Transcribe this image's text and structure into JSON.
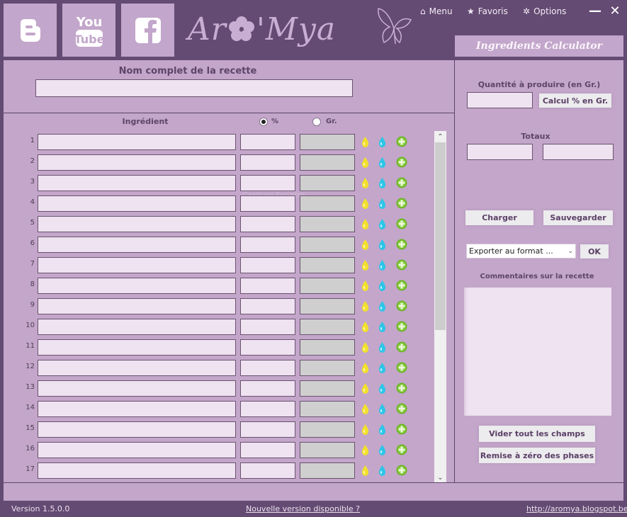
{
  "social": {
    "blogger_label": "Blogger",
    "youtube_label": "YouTube",
    "facebook_label": "Facebook"
  },
  "logo": {
    "part1": "Ar",
    "part2": "'Mya"
  },
  "menu": {
    "items": [
      {
        "icon": "home-icon",
        "glyph": "⌂",
        "label": "Menu"
      },
      {
        "icon": "star-icon",
        "glyph": "★",
        "label": "Favoris"
      },
      {
        "icon": "options-icon",
        "glyph": "✲",
        "label": "Options"
      }
    ],
    "minimize": "—",
    "close": "✕"
  },
  "right_header": {
    "title": "Ingredients Calculator"
  },
  "recipe": {
    "name_label": "Nom complet de la recette",
    "name_value": ""
  },
  "ingredients": {
    "column_label": "Ingrédient",
    "unit_options": [
      {
        "label": "%",
        "selected": true
      },
      {
        "label": "Gr.",
        "selected": false
      }
    ],
    "rows": [
      {
        "n": "1",
        "name": "",
        "value": "",
        "grams": ""
      },
      {
        "n": "2",
        "name": "",
        "value": "",
        "grams": ""
      },
      {
        "n": "3",
        "name": "",
        "value": "",
        "grams": ""
      },
      {
        "n": "4",
        "name": "",
        "value": "",
        "grams": ""
      },
      {
        "n": "5",
        "name": "",
        "value": "",
        "grams": ""
      },
      {
        "n": "6",
        "name": "",
        "value": "",
        "grams": ""
      },
      {
        "n": "7",
        "name": "",
        "value": "",
        "grams": ""
      },
      {
        "n": "8",
        "name": "",
        "value": "",
        "grams": ""
      },
      {
        "n": "9",
        "name": "",
        "value": "",
        "grams": ""
      },
      {
        "n": "10",
        "name": "",
        "value": "",
        "grams": ""
      },
      {
        "n": "11",
        "name": "",
        "value": "",
        "grams": ""
      },
      {
        "n": "12",
        "name": "",
        "value": "",
        "grams": ""
      },
      {
        "n": "13",
        "name": "",
        "value": "",
        "grams": ""
      },
      {
        "n": "14",
        "name": "",
        "value": "",
        "grams": ""
      },
      {
        "n": "15",
        "name": "",
        "value": "",
        "grams": ""
      },
      {
        "n": "16",
        "name": "",
        "value": "",
        "grams": ""
      },
      {
        "n": "17",
        "name": "",
        "value": "",
        "grams": ""
      }
    ],
    "row_icons": [
      "yellow-drop-icon",
      "blue-drop-icon",
      "green-plus-icon"
    ],
    "ghost_text": "Capture Fenetre"
  },
  "calculator": {
    "quantity_label": "Quantité à produire (en Gr.)",
    "quantity_value": "",
    "calc_button": "Calcul % en Gr.",
    "totals_label": "Totaux",
    "total_percent": "",
    "total_grams": "",
    "load_button": "Charger",
    "save_button": "Sauvegarder",
    "export_select": "Exporter au format ...",
    "ok_button": "OK",
    "comments_label": "Commentaires sur la recette",
    "comments_value": "",
    "clear_button": "Vider tout les champs",
    "reset_button": "Remise à zéro des phases"
  },
  "footer": {
    "version": "Version 1.5.0.0",
    "update_link": "Nouvelle version disponible ?",
    "site_link": "http://aromya.blogspot.be"
  },
  "colors": {
    "frame": "#644b73",
    "panel": "#c3a6ca",
    "field": "#efe2f1",
    "field_gray": "#cfcfcf",
    "text": "#5e4569"
  }
}
